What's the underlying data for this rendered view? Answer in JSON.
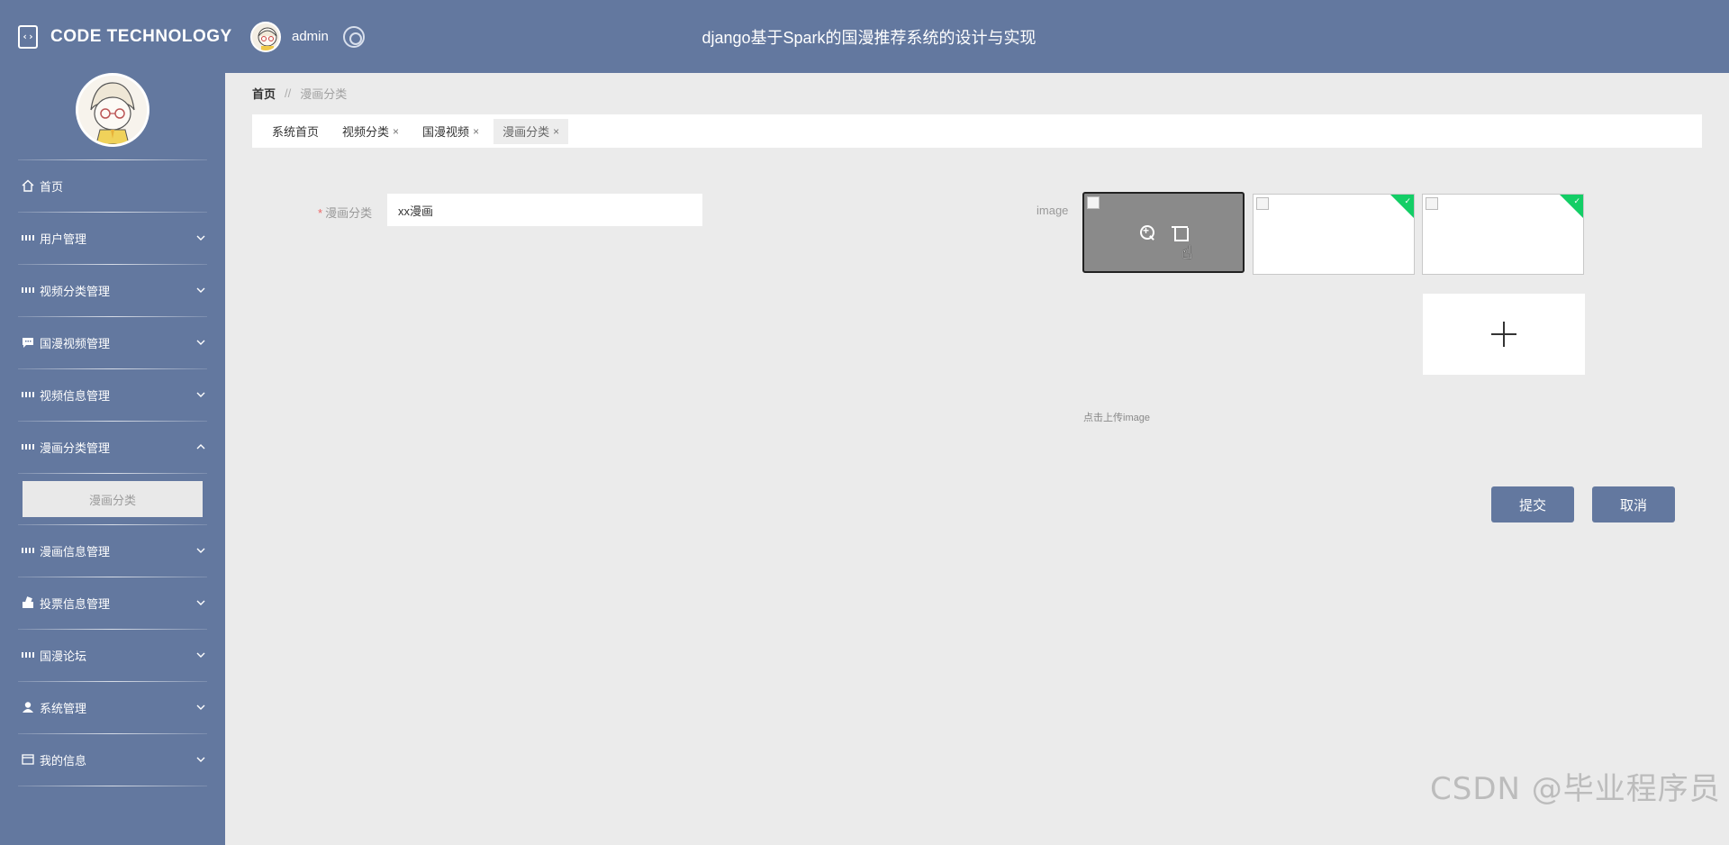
{
  "header": {
    "brand": "CODE TECHNOLOGY",
    "user": "admin",
    "title": "django基于Spark的国漫推荐系统的设计与实现",
    "bg_color": "#63789f"
  },
  "sidebar": {
    "items": [
      {
        "label": "首页",
        "icon": "home-icon"
      },
      {
        "label": "用户管理",
        "icon": "grid-icon"
      },
      {
        "label": "视频分类管理",
        "icon": "grid-icon"
      },
      {
        "label": "国漫视频管理",
        "icon": "chat-icon"
      },
      {
        "label": "视频信息管理",
        "icon": "grid-icon"
      },
      {
        "label": "漫画分类管理",
        "icon": "grid-icon",
        "expanded": true
      },
      {
        "label": "漫画信息管理",
        "icon": "grid-icon"
      },
      {
        "label": "投票信息管理",
        "icon": "vote-icon"
      },
      {
        "label": "国漫论坛",
        "icon": "grid-icon"
      },
      {
        "label": "系统管理",
        "icon": "user-icon"
      },
      {
        "label": "我的信息",
        "icon": "card-icon"
      }
    ],
    "active_sub": "漫画分类"
  },
  "breadcrumb": {
    "home": "首页",
    "sep": "//",
    "current": "漫画分类"
  },
  "tabs": [
    {
      "label": "系统首页",
      "closable": false
    },
    {
      "label": "视频分类",
      "closable": true
    },
    {
      "label": "国漫视频",
      "closable": true
    },
    {
      "label": "漫画分类",
      "closable": true,
      "active": true
    }
  ],
  "tab_close": "×",
  "form": {
    "category_label": "漫画分类",
    "required_mark": "*",
    "category_value": "xx漫画",
    "image_label": "image",
    "upload_hint": "点击上传image",
    "submit": "提交",
    "cancel": "取消"
  },
  "watermark": "CSDN @毕业程序员"
}
